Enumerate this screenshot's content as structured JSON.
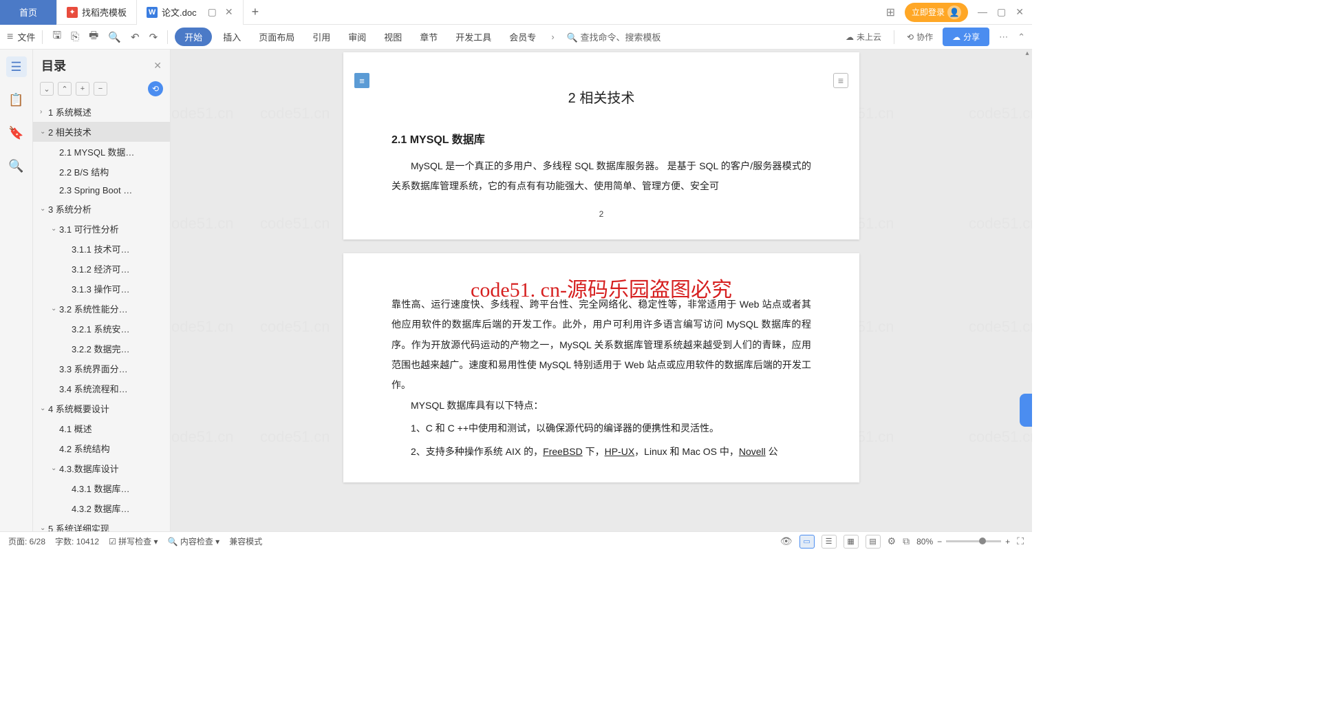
{
  "titlebar": {
    "home": "首页",
    "tab1": "找稻壳模板",
    "tab2": "论文.doc",
    "login": "立即登录"
  },
  "menubar": {
    "file": "文件",
    "items": [
      "开始",
      "插入",
      "页面布局",
      "引用",
      "审阅",
      "视图",
      "章节",
      "开发工具",
      "会员专"
    ],
    "search": "查找命令、搜索模板",
    "cloud": "未上云",
    "collab": "协作",
    "share": "分享"
  },
  "outline": {
    "title": "目录",
    "items": [
      {
        "l": 0,
        "caret": "›",
        "label": "1 系统概述"
      },
      {
        "l": 0,
        "caret": "⌄",
        "label": "2 相关技术",
        "active": true
      },
      {
        "l": 1,
        "caret": "",
        "label": "2.1 MYSQL 数据…"
      },
      {
        "l": 1,
        "caret": "",
        "label": "2.2 B/S 结构"
      },
      {
        "l": 1,
        "caret": "",
        "label": "2.3 Spring Boot …"
      },
      {
        "l": 0,
        "caret": "⌄",
        "label": "3 系统分析"
      },
      {
        "l": 1,
        "caret": "⌄",
        "label": "3.1 可行性分析"
      },
      {
        "l": 2,
        "caret": "",
        "label": "3.1.1 技术可…"
      },
      {
        "l": 2,
        "caret": "",
        "label": "3.1.2 经济可…"
      },
      {
        "l": 2,
        "caret": "",
        "label": "3.1.3 操作可…"
      },
      {
        "l": 1,
        "caret": "⌄",
        "label": "3.2 系统性能分…"
      },
      {
        "l": 2,
        "caret": "",
        "label": "3.2.1 系统安…"
      },
      {
        "l": 2,
        "caret": "",
        "label": "3.2.2 数据完…"
      },
      {
        "l": 1,
        "caret": "",
        "label": "3.3 系统界面分…"
      },
      {
        "l": 1,
        "caret": "",
        "label": "3.4 系统流程和…"
      },
      {
        "l": 0,
        "caret": "⌄",
        "label": "4 系统概要设计"
      },
      {
        "l": 1,
        "caret": "",
        "label": "4.1 概述"
      },
      {
        "l": 1,
        "caret": "",
        "label": "4.2 系统结构"
      },
      {
        "l": 1,
        "caret": "⌄",
        "label": "4.3.数据库设计"
      },
      {
        "l": 2,
        "caret": "",
        "label": "4.3.1 数据库…"
      },
      {
        "l": 2,
        "caret": "",
        "label": "4.3.2 数据库…"
      },
      {
        "l": 0,
        "caret": "⌄",
        "label": "5 系统详细实现"
      }
    ]
  },
  "doc": {
    "h1": "2 相关技术",
    "h2_1": "2.1 MYSQL 数据库",
    "p1": "MySQL 是一个真正的多用户、多线程 SQL 数据库服务器。 是基于 SQL 的客户/服务器模式的关系数据库管理系统，它的有点有有功能强大、使用简单、管理方便、安全可",
    "pagenum": "2",
    "p2": "靠性高、运行速度快、多线程、跨平台性、完全网络化、稳定性等，非常适用于 Web 站点或者其他应用软件的数据库后端的开发工作。此外，用户可利用许多语言编写访问 MySQL 数据库的程序。作为开放源代码运动的产物之一，MySQL 关系数据库管理系统越来越受到人们的青睐，应用范围也越来越广。速度和易用性使 MySQL 特别适用于 Web 站点或应用软件的数据库后端的开发工作。",
    "p3": "MYSQL 数据库具有以下特点：",
    "f1": "1、C 和 C ++中使用和测试，以确保源代码的编译器的便携性和灵活性。",
    "f2_a": "2、支持多种操作系统 AIX 的，",
    "f2_b": "FreeBSD",
    "f2_c": " 下，",
    "f2_d": "HP-UX",
    "f2_e": "，Linux 和 Mac OS 中，",
    "f2_f": "Novell",
    "f2_g": " 公"
  },
  "overlay": "code51. cn-源码乐园盗图必究",
  "watermark": "code51.cn",
  "statusbar": {
    "page": "页面: 6/28",
    "words": "字数: 10412",
    "spell": "拼写检查",
    "content": "内容检查",
    "compat": "兼容模式",
    "zoom": "80%"
  }
}
